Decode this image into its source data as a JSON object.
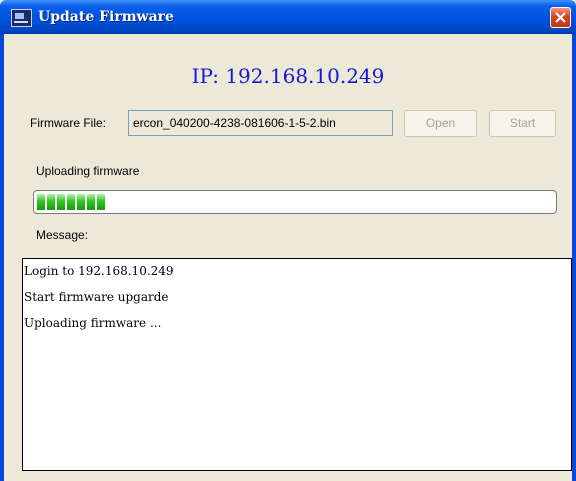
{
  "window": {
    "title": "Update Firmware"
  },
  "header": {
    "ip": "IP: 192.168.10.249"
  },
  "form": {
    "firmware_file_label": "Firmware File:",
    "firmware_file_value": "ercon_040200-4238-081606-1-5-2.bin",
    "open_label": "Open",
    "start_label": "Start"
  },
  "progress": {
    "status_label": "Uploading firmware",
    "segments": 7,
    "fraction": 0.15
  },
  "messages": {
    "label": "Message:",
    "lines": [
      "Login to 192.168.10.249",
      "Start firmware upgarde",
      "Uploading firmware ..."
    ]
  },
  "colors": {
    "titlebar": "#0054e3",
    "ip_text": "#1416d8",
    "progress": "#30c820",
    "close": "#d7431c"
  }
}
